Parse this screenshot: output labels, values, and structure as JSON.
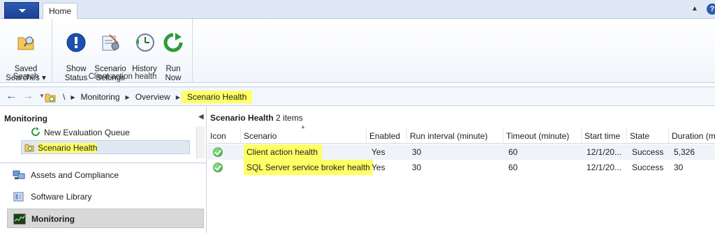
{
  "ribbon": {
    "tab_home": "Home",
    "groups": {
      "search": {
        "label": "Search",
        "saved_searches": "Saved\nSearches ▾"
      },
      "client_action_health": {
        "label": "Client action health",
        "show_status": "Show\nStatus",
        "scenario_settings": "Scenario\nSettings",
        "history": "History",
        "run_now": "Run\nNow"
      }
    }
  },
  "address": {
    "root": "\\",
    "crumbs": [
      "Monitoring",
      "Overview",
      "Scenario Health"
    ]
  },
  "left_pane": {
    "title": "Monitoring",
    "tree": [
      "New Evaluation Queue",
      "Scenario Health"
    ],
    "workspaces": [
      "Assets and Compliance",
      "Software Library",
      "Monitoring"
    ]
  },
  "main": {
    "title": "Scenario Health",
    "count": "2 items",
    "columns": [
      "Icon",
      "Scenario",
      "Enabled",
      "Run interval (minute)",
      "Timeout (minute)",
      "Start time",
      "State",
      "Duration (m"
    ],
    "rows": [
      {
        "scenario": "Client action health",
        "enabled": "Yes",
        "run_interval": "30",
        "timeout": "60",
        "start_time": "12/1/20...",
        "state": "Success",
        "duration": "5,326"
      },
      {
        "scenario": "SQL Server service broker health",
        "enabled": "Yes",
        "run_interval": "30",
        "timeout": "60",
        "start_time": "12/1/20...",
        "state": "Success",
        "duration": "30"
      }
    ]
  },
  "colors": {
    "highlight": "#ffff66",
    "accent": "#2a5db0",
    "success": "#2f9a2f"
  }
}
